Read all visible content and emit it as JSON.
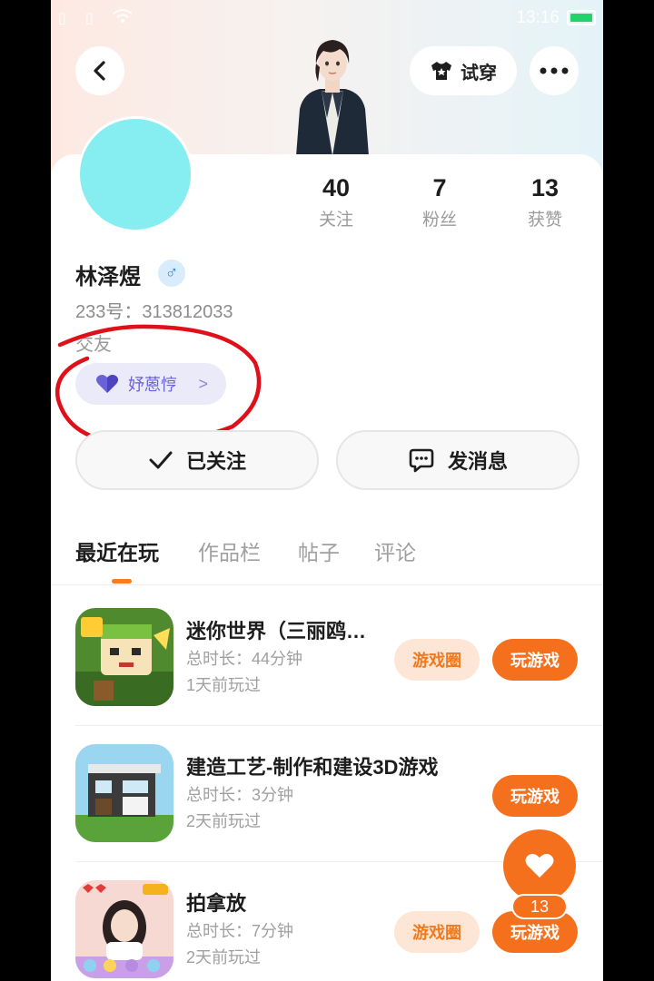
{
  "status_bar": {
    "time": "13:16"
  },
  "header": {
    "try_on_label": "试穿"
  },
  "profile": {
    "stats": [
      {
        "value": "40",
        "label": "关注"
      },
      {
        "value": "7",
        "label": "粉丝"
      },
      {
        "value": "13",
        "label": "获赞"
      }
    ],
    "name": "林泽煜",
    "gender_symbol": "♂",
    "id_text": "233号：313812033",
    "tag_text": "交友",
    "relation_pill": "妤蒽悙",
    "colors": {
      "avatar": "#86eef1",
      "accent": "#f4701d",
      "annotation": "#e0101a"
    }
  },
  "actions": {
    "follow_label": "已关注",
    "message_label": "发消息"
  },
  "tabs": [
    "最近在玩",
    "作品栏",
    "帖子",
    "评论"
  ],
  "games": [
    {
      "name": "迷你世界（三丽鸥…",
      "duration": "总时长：44分钟",
      "last_played": "1天前玩过",
      "circle_label": "游戏圈",
      "play_label": "玩游戏"
    },
    {
      "name": "建造工艺-制作和建设3D游戏",
      "duration": "总时长：3分钟",
      "last_played": "2天前玩过",
      "play_label": "玩游戏"
    },
    {
      "name": "拍拿放",
      "duration": "总时长：7分钟",
      "last_played": "2天前玩过",
      "circle_label": "游戏圈",
      "play_label": "玩游戏"
    }
  ],
  "like_count": "13"
}
